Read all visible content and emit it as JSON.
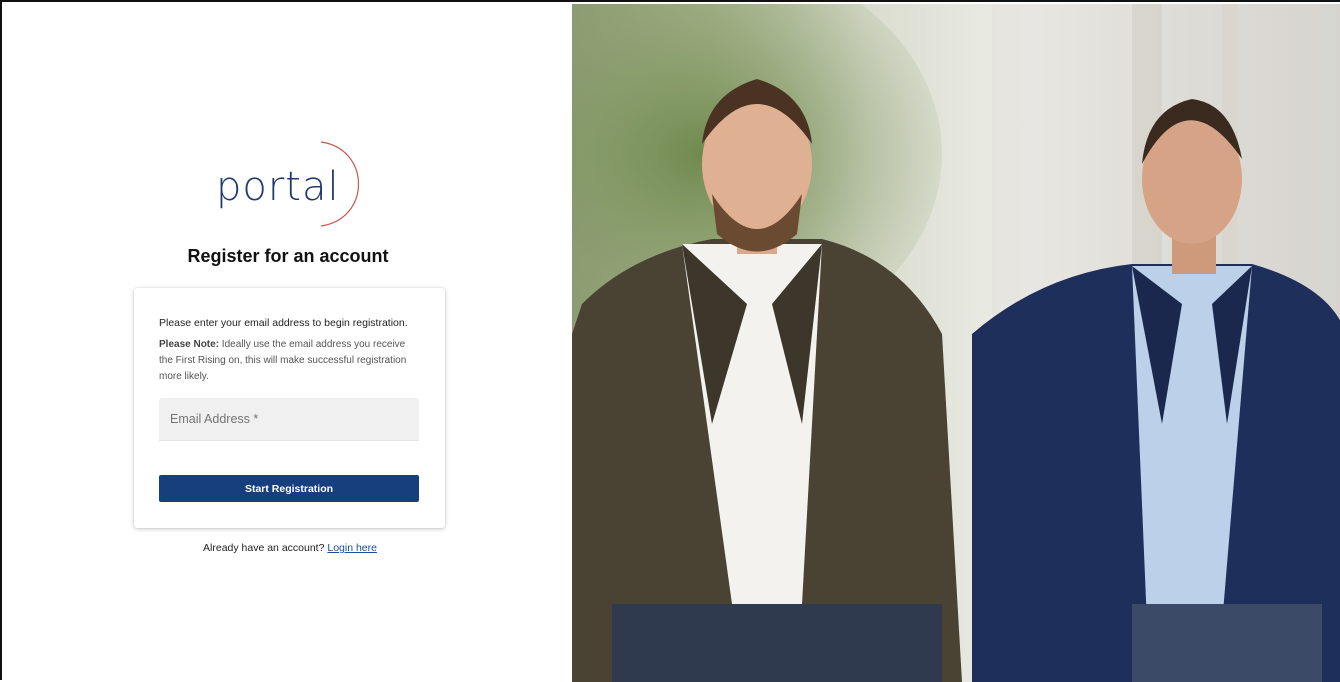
{
  "logo": {
    "text": "portal"
  },
  "title": "Register for an account",
  "form": {
    "intro": "Please enter your email address to begin registration.",
    "note_label": "Please Note:",
    "note_text": " Ideally use the email address you receive the First Rising on, this will make successful registration more likely.",
    "email_placeholder": "Email Address *",
    "submit_label": "Start Registration"
  },
  "login": {
    "prompt": "Already have an account? ",
    "link_text": "Login here"
  },
  "colors": {
    "primary": "#173f7d",
    "logo_text": "#1f3a6e",
    "logo_accent": "#c8564a",
    "link": "#1a4fa0"
  },
  "photo": {
    "icon": "hero-photo"
  }
}
